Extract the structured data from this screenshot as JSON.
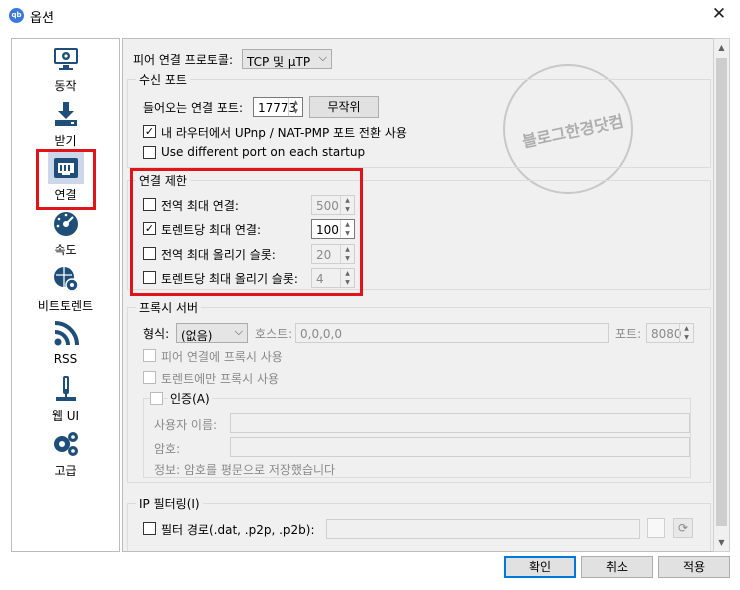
{
  "window": {
    "title": "옵션",
    "app_icon": "qb",
    "close": "✕"
  },
  "sidebar": {
    "items": [
      {
        "label": "동작",
        "icon": "monitor-gear-icon"
      },
      {
        "label": "받기",
        "icon": "download-icon"
      },
      {
        "label": "연결",
        "icon": "network-icon",
        "selected": true
      },
      {
        "label": "속도",
        "icon": "speedometer-icon"
      },
      {
        "label": "비트토렌트",
        "icon": "globe-gear-icon"
      },
      {
        "label": "RSS",
        "icon": "rss-icon"
      },
      {
        "label": "웹 UI",
        "icon": "web-ui-icon"
      },
      {
        "label": "고급",
        "icon": "gears-icon"
      }
    ]
  },
  "connection": {
    "protocol_label": "피어 연결 프로토콜:",
    "protocol_value": "TCP 및 µTP",
    "listening_port": {
      "title": "수신 포트",
      "port_label": "들어오는 연결 포트:",
      "port_value": "17773",
      "random_button": "무작위",
      "upnp_label": "내 라우터에서 UPnp / NAT-PMP 포트 전환 사용",
      "upnp_checked": true,
      "diff_port_label": "Use different port on each startup",
      "diff_port_checked": false
    },
    "limits": {
      "title": "연결 제한",
      "rows": [
        {
          "label": "전역 최대 연결:",
          "value": "500",
          "checked": false
        },
        {
          "label": "토렌트당 최대 연결:",
          "value": "100",
          "checked": true
        },
        {
          "label": "전역 최대 올리기 슬롯:",
          "value": "20",
          "checked": false
        },
        {
          "label": "토렌트당 최대 올리기 슬롯:",
          "value": "4",
          "checked": false
        }
      ]
    },
    "proxy": {
      "title": "프록시 서버",
      "type_label": "형식:",
      "type_value": "(없음)",
      "host_label": "호스트:",
      "host_value": "0,0,0,0",
      "port_label": "포트:",
      "port_value": "8080",
      "peer_label": "피어 연결에 프록시 사용",
      "torrent_only_label": "토렌트에만 프록시 사용",
      "auth_title": "인증(A)",
      "username_label": "사용자 이름:",
      "password_label": "암호:",
      "info_text": "정보: 암호를 평문으로 저장했습니다"
    },
    "ip_filter": {
      "title": "IP 필터링(I)",
      "path_label": "필터 경로(.dat, .p2p, .p2b):"
    }
  },
  "buttons": {
    "ok": "확인",
    "cancel": "취소",
    "apply": "적용"
  },
  "watermark": {
    "text": "블로그한경닷컴"
  },
  "colors": {
    "highlight": "#e0141b",
    "focus": "#0078d7",
    "selected_bg": "#ccd8ea"
  }
}
